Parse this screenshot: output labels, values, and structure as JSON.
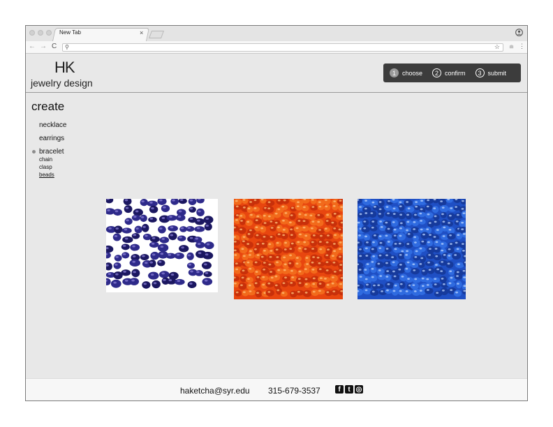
{
  "browser": {
    "tab_title": "New Tab",
    "tab_close": "×",
    "back": "←",
    "forward": "→",
    "reload": "C",
    "search_glyph": "⚲",
    "star": "☆",
    "menu": "⋮",
    "url_value": ""
  },
  "header": {
    "logo_mark": "HK",
    "logo_text": "jewelry design",
    "steps": [
      {
        "num": "1",
        "label": "choose",
        "active": true
      },
      {
        "num": "2",
        "label": "confirm",
        "active": false
      },
      {
        "num": "3",
        "label": "submit",
        "active": false
      }
    ]
  },
  "sidebar": {
    "heading": "create",
    "items": [
      {
        "label": "necklace"
      },
      {
        "label": "earrings"
      },
      {
        "label": "bracelet",
        "selected": true
      }
    ],
    "subitems": [
      {
        "label": "chain"
      },
      {
        "label": "clasp"
      },
      {
        "label": "beads",
        "active": true
      }
    ]
  },
  "products": [
    {
      "name": "purple beads",
      "color": "#3a2a8c"
    },
    {
      "name": "orange beads",
      "color": "#f06a1a"
    },
    {
      "name": "blue beads",
      "color": "#2a5ed8"
    }
  ],
  "footer": {
    "email": "haketcha@syr.edu",
    "phone": "315-679-3537",
    "social": [
      {
        "icon": "facebook-icon",
        "glyph": "f"
      },
      {
        "icon": "twitter-icon",
        "glyph": "t"
      },
      {
        "icon": "instagram-icon",
        "glyph": "◎"
      }
    ]
  }
}
